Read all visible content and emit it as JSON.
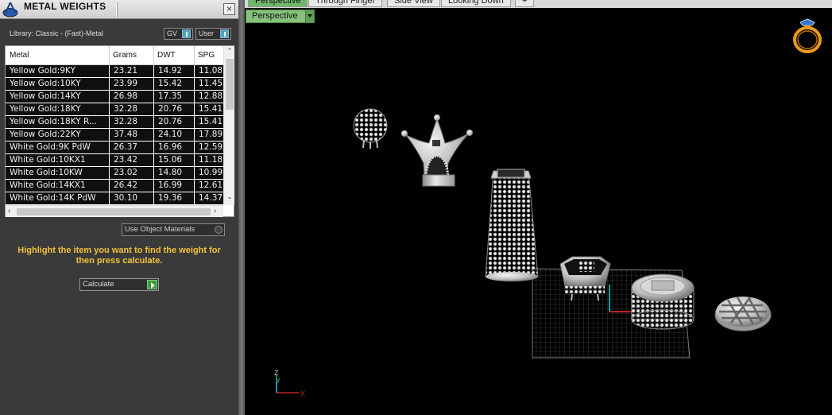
{
  "panel": {
    "title": "METAL WEIGHTS",
    "close_label": "×",
    "library_label": "Library: Classic - (Fast)-Metal",
    "toggle_gv": "GV",
    "toggle_user": "User",
    "table": {
      "headers": [
        "Metal",
        "Grams",
        "DWT",
        "SPG"
      ],
      "rows": [
        [
          "Yellow Gold:9KY",
          "23.21",
          "14.92",
          "11.08"
        ],
        [
          "Yellow Gold:10KY",
          "23.99",
          "15.42",
          "11.45"
        ],
        [
          "Yellow Gold:14KY",
          "26.98",
          "17.35",
          "12.88"
        ],
        [
          "Yellow Gold:18KY",
          "32.28",
          "20.76",
          "15.41"
        ],
        [
          "Yellow Gold:18KY R...",
          "32.28",
          "20.76",
          "15.41"
        ],
        [
          "Yellow Gold:22KY",
          "37.48",
          "24.10",
          "17.89"
        ],
        [
          "White Gold:9K PdW",
          "26.37",
          "16.96",
          "12.59"
        ],
        [
          "White Gold:10KX1",
          "23.42",
          "15.06",
          "11.18"
        ],
        [
          "White Gold:10KW",
          "23.02",
          "14.80",
          "10.99"
        ],
        [
          "White Gold:14KX1",
          "26.42",
          "16.99",
          "12.61"
        ],
        [
          "White Gold:14K PdW",
          "30.10",
          "19.36",
          "14.37"
        ]
      ]
    },
    "use_object_materials": "Use Object Materials",
    "hint": "Highlight the item you want to find the weight for then press calculate.",
    "calculate_label": "Calculate"
  },
  "viewport": {
    "tabs": [
      "Perspective",
      "Through Finger",
      "Side View",
      "Looking Down",
      "+"
    ],
    "active_tab": "Perspective",
    "view_dropdown": "Perspective",
    "axis_labels": {
      "z": "Z",
      "y": "Y",
      "x": "X"
    }
  },
  "colors": {
    "accent_green": "#86c27c",
    "hint_yellow": "#f2c13a",
    "panel_bg": "#3a3a3a",
    "viewport_bg": "#000000"
  }
}
